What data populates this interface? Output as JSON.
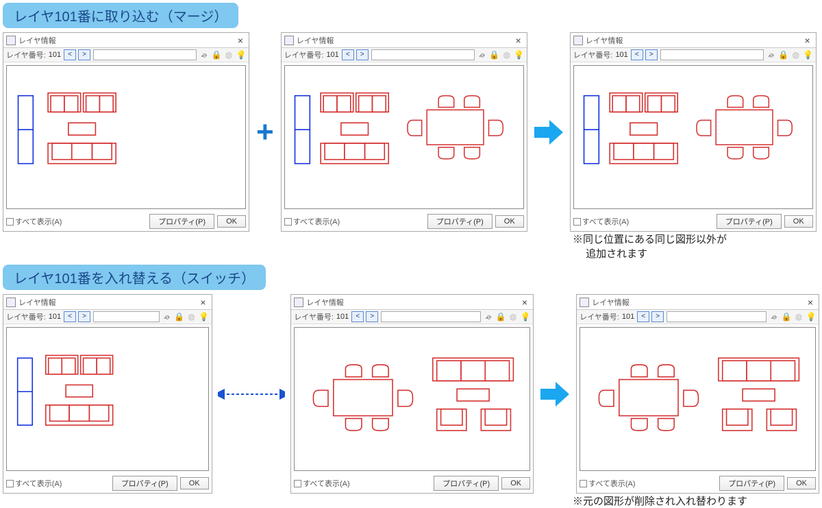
{
  "headings": {
    "merge": "レイヤ101番に取り込む（マージ）",
    "switch": "レイヤ101番を入れ替える（スイッチ）"
  },
  "notes": {
    "merge_1": "※同じ位置にある同じ図形以外が",
    "merge_2": "　 追加されます",
    "switch": "※元の図形が削除され入れ替わります"
  },
  "panel": {
    "title": "レイヤ情報",
    "layer_label": "レイヤ番号:",
    "layer_number": "101",
    "show_all": "すべて表示(A)",
    "prop_btn": "プロパティ(P)",
    "ok_btn": "OK"
  }
}
